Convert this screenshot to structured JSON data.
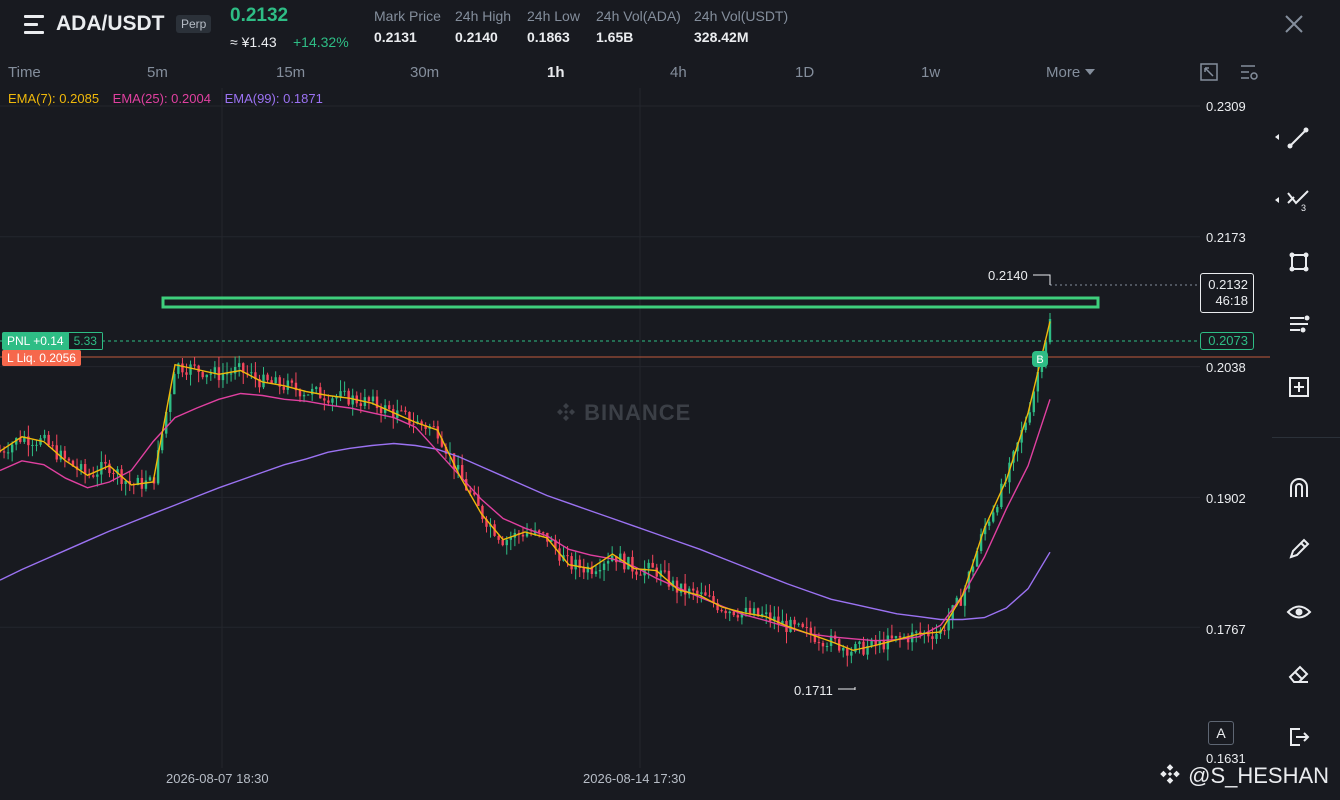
{
  "header": {
    "pair": "ADA/USDT",
    "contract_type": "Perp",
    "last_price": "0.2132",
    "fiat_price": "≈ ¥1.43",
    "change_pct": "+14.32%",
    "stats": [
      {
        "label": "Mark Price",
        "value": "0.2131"
      },
      {
        "label": "24h High",
        "value": "0.2140"
      },
      {
        "label": "24h Low",
        "value": "0.1863"
      },
      {
        "label": "24h Vol(ADA)",
        "value": "1.65B"
      },
      {
        "label": "24h Vol(USDT)",
        "value": "328.42M"
      }
    ]
  },
  "timeframes": [
    "Time",
    "5m",
    "15m",
    "30m",
    "1h",
    "4h",
    "1D",
    "1w",
    "More"
  ],
  "active_timeframe": "1h",
  "indicators": {
    "ema7": "EMA(7): 0.2085",
    "ema25": "EMA(25): 0.2004",
    "ema99": "EMA(99): 0.1871"
  },
  "price_axis": [
    "0.2309",
    "0.2173",
    "0.2038",
    "0.1902",
    "0.1767",
    "0.1631"
  ],
  "current_price": {
    "price": "0.2132",
    "countdown": "46:18"
  },
  "entry_price": "0.2073",
  "position": {
    "pnl": "PNL +0.14",
    "size": "5.33",
    "liquidation": "L Liq. 0.2056",
    "buy_marker": "B"
  },
  "annotations": {
    "high": "0.2140",
    "low": "0.1711"
  },
  "watermark": "BINANCE",
  "time_axis": [
    "2026-08-07 18:30",
    "2026-08-14 17:30"
  ],
  "auto_scale": "A",
  "credit": "@S_HESHAN",
  "tools": [
    "line-tool-icon",
    "fib-tool-icon",
    "shape-tool-icon",
    "text-tool-icon",
    "measure-tool-icon",
    "magnet-icon",
    "pencil-icon",
    "eye-icon",
    "eraser-icon",
    "exit-icon"
  ],
  "colors": {
    "background": "#181a20",
    "up": "#2ebd85",
    "down": "#f6465d",
    "ema7": "#f0b90b",
    "ema25": "#e040a0",
    "ema99": "#9b72f2",
    "resistance_box": "#3ecf7c",
    "liquidation": "#f6684c"
  },
  "chart_data": {
    "type": "candlestick",
    "price_range": [
      0.1631,
      0.2309
    ],
    "ema7": [
      0.195,
      0.1965,
      0.196,
      0.194,
      0.1925,
      0.1935,
      0.1915,
      0.1918,
      0.204,
      0.2035,
      0.203,
      0.2034,
      0.2022,
      0.2018,
      0.2012,
      0.2008,
      0.2005,
      0.2,
      0.199,
      0.198,
      0.1972,
      0.1925,
      0.1885,
      0.1858,
      0.1866,
      0.186,
      0.1832,
      0.1828,
      0.1843,
      0.1828,
      0.1826,
      0.1806,
      0.18,
      0.1788,
      0.1782,
      0.1778,
      0.1768,
      0.176,
      0.1752,
      0.1743,
      0.1748,
      0.1754,
      0.176,
      0.1762,
      0.18,
      0.187,
      0.192,
      0.199,
      0.2085
    ],
    "ema25": [
      0.193,
      0.194,
      0.1936,
      0.1922,
      0.1912,
      0.1918,
      0.193,
      0.196,
      0.1985,
      0.1995,
      0.2004,
      0.201,
      0.2008,
      0.2004,
      0.2002,
      0.1998,
      0.1995,
      0.199,
      0.1985,
      0.1975,
      0.195,
      0.1925,
      0.19,
      0.188,
      0.187,
      0.1862,
      0.1848,
      0.1842,
      0.1838,
      0.183,
      0.1818,
      0.1808,
      0.1798,
      0.1789,
      0.178,
      0.1774,
      0.1767,
      0.176,
      0.1757,
      0.1755,
      0.1753,
      0.1754,
      0.1757,
      0.1769,
      0.18,
      0.184,
      0.189,
      0.1935,
      0.2004
    ],
    "ema99": [
      0.1816,
      0.1827,
      0.1837,
      0.1847,
      0.1857,
      0.1867,
      0.1876,
      0.1885,
      0.1894,
      0.1903,
      0.1912,
      0.192,
      0.1928,
      0.1936,
      0.1942,
      0.1949,
      0.1953,
      0.1956,
      0.1958,
      0.1956,
      0.1952,
      0.1944,
      0.1934,
      0.1924,
      0.1914,
      0.1904,
      0.1896,
      0.1888,
      0.188,
      0.1872,
      0.1864,
      0.1856,
      0.1848,
      0.1839,
      0.183,
      0.1821,
      0.1812,
      0.1804,
      0.1796,
      0.1791,
      0.1786,
      0.1781,
      0.1778,
      0.1775,
      0.1775,
      0.1777,
      0.1787,
      0.1807,
      0.1845
    ]
  }
}
